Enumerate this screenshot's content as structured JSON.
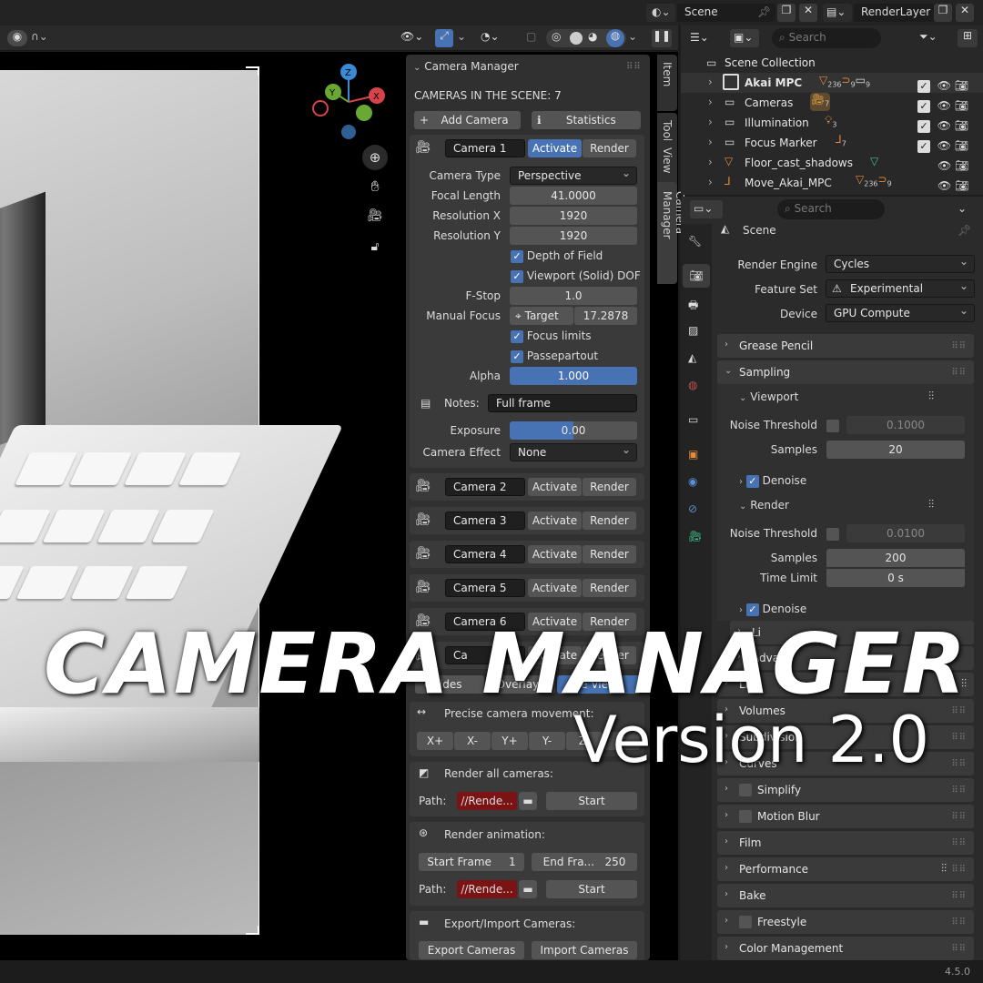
{
  "topbar": {
    "scene": "Scene",
    "view_layer": "RenderLayer"
  },
  "outliner": {
    "search_placeholder": "Search",
    "root": "Scene Collection",
    "items": [
      {
        "label": "Akai MPC",
        "counts": [
          "236",
          "9",
          "9"
        ],
        "bold": true
      },
      {
        "label": "Cameras",
        "counts": [
          "7"
        ]
      },
      {
        "label": "Illumination",
        "counts": [
          "3"
        ]
      },
      {
        "label": "Focus Marker",
        "counts": [
          "7"
        ]
      },
      {
        "label": "Floor_cast_shadows",
        "counts": []
      },
      {
        "label": "Move_Akai_MPC",
        "counts": [
          "236",
          "9"
        ]
      }
    ]
  },
  "props": {
    "search_placeholder": "Search",
    "context": "Scene",
    "render_engine_label": "Render Engine",
    "render_engine": "Cycles",
    "feature_set_label": "Feature Set",
    "feature_set": "Experimental",
    "device_label": "Device",
    "device": "GPU Compute",
    "grease_pencil": "Grease Pencil",
    "sampling": "Sampling",
    "viewport": "Viewport",
    "noise_threshold_label": "Noise Threshold",
    "viewport_noise": "0.1000",
    "samples_label": "Samples",
    "viewport_samples": "20",
    "denoise": "Denoise",
    "render": "Render",
    "render_noise": "0.0100",
    "render_samples": "200",
    "time_limit_label": "Time Limit",
    "time_limit": "0 s",
    "lights_partial": "Li",
    "adv_partial": "Adva",
    "light_paths_partial": "Lig",
    "volumes": "Volumes",
    "subdivision": "Subdivision",
    "curves": "Curves",
    "simplify": "Simplify",
    "motion_blur": "Motion Blur",
    "film": "Film",
    "performance": "Performance",
    "bake": "Bake",
    "freestyle": "Freestyle",
    "color_management": "Color Management"
  },
  "cm": {
    "title": "Camera Manager",
    "cameras_count": "CAMERAS IN THE SCENE: 7",
    "add_camera": "Add Camera",
    "statistics": "Statistics",
    "activate": "Activate",
    "render": "Render",
    "camera1": "Camera 1",
    "camera_type_label": "Camera Type",
    "camera_type": "Perspective",
    "focal_length_label": "Focal Length",
    "focal_length": "41.0000",
    "res_x_label": "Resolution X",
    "res_x": "1920",
    "res_y_label": "Resolution Y",
    "res_y": "1920",
    "dof": "Depth of Field",
    "viewport_dof": "Viewport (Solid) DOF",
    "fstop_label": "F-Stop",
    "fstop": "1.0",
    "manual_focus_label": "Manual Focus",
    "target": "Target",
    "target_val": "17.2878",
    "focus_limits": "Focus limits",
    "passepartout": "Passepartout",
    "alpha_label": "Alpha",
    "alpha": "1.000",
    "notes_label": "Notes:",
    "notes": "Full frame",
    "exposure_label": "Exposure",
    "exposure": "0.00",
    "camera_effect_label": "Camera Effect",
    "camera_effect": "None",
    "cameras": [
      "Camera 2",
      "Camera 3",
      "Camera 4",
      "Camera 5",
      "Camera 6",
      "Ca"
    ],
    "guides": "Guides",
    "overlays": "Overlays",
    "view": "e View",
    "precise": "Precise camera movement:",
    "moves": [
      "X+",
      "X-",
      "Y+",
      "Y-",
      "Z-",
      "Z"
    ],
    "render_all": "Render all cameras:",
    "path_label": "Path:",
    "path": "//Rende...",
    "start": "Start",
    "render_anim": "Render animation:",
    "start_frame_label": "Start Frame",
    "start_frame": "1",
    "end_frame_label": "End Fra...",
    "end_frame": "250",
    "export_import": "Export/Import Cameras:",
    "export": "Export Cameras",
    "import": "Import Cameras"
  },
  "tabs": [
    "Item",
    "Tool",
    "View",
    "Camera Manager"
  ],
  "overlay": {
    "title": "CAMERA MANAGER",
    "subtitle": "Version 2.0"
  },
  "version": "4.5.0"
}
